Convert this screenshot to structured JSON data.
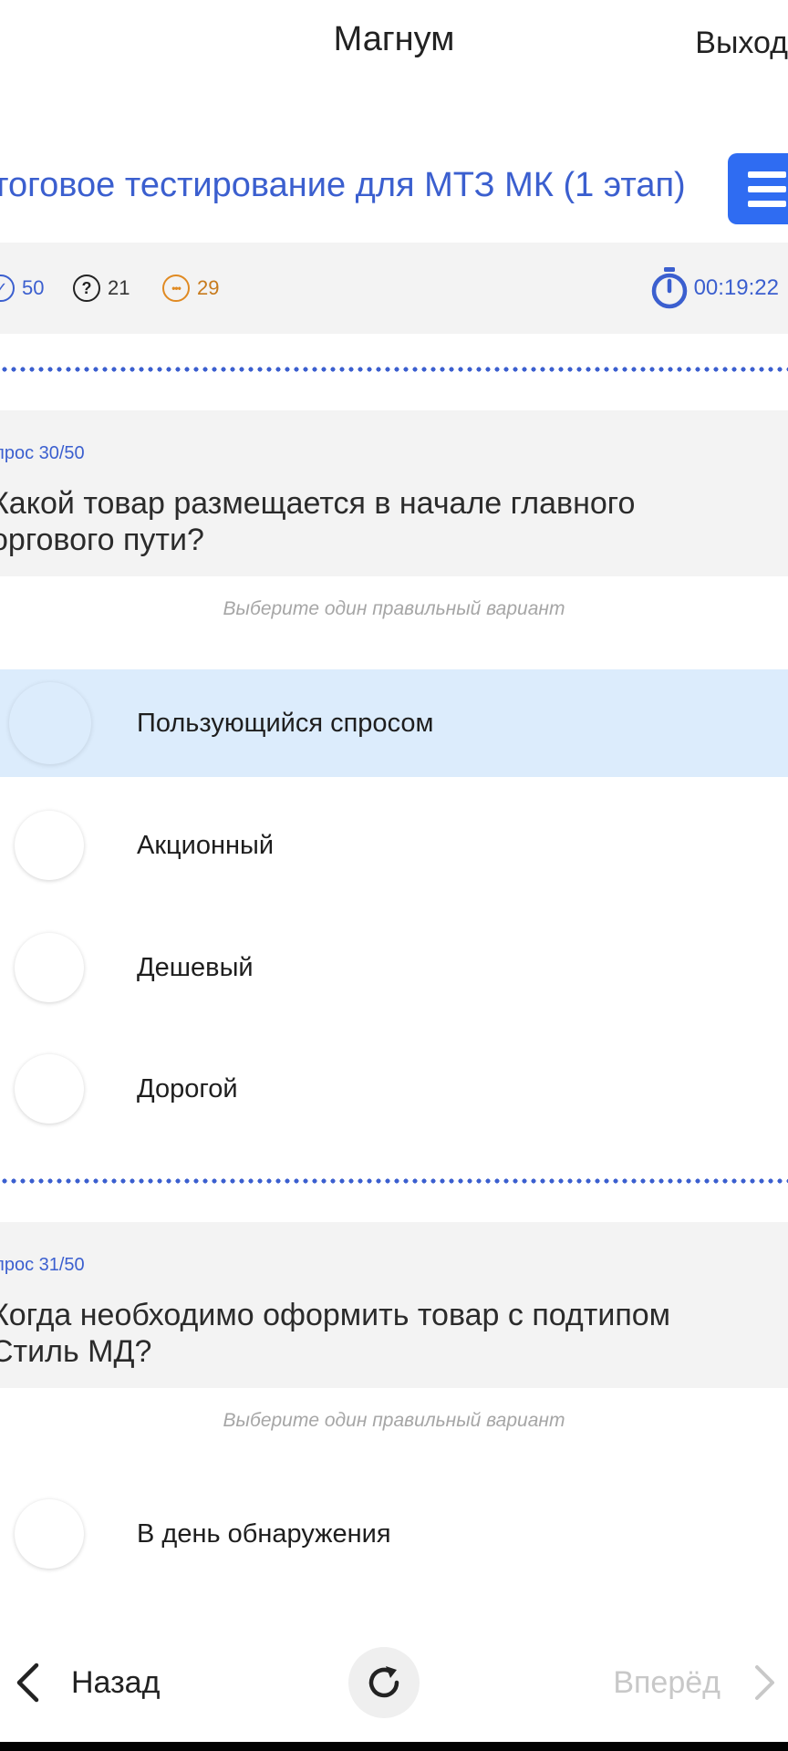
{
  "header": {
    "app_title": "Магнум",
    "logout_label": "Выход"
  },
  "test": {
    "title": "тоговое тестирование для МТЗ МК (1 этап)"
  },
  "stats": {
    "total": "50",
    "unanswered": "21",
    "answered": "29",
    "timer": "00:19:22"
  },
  "questions": [
    {
      "number_label": "прос 30/50",
      "text": "Какой товар размещается в начале главного оргового пути?",
      "hint": "Выберите один правильный вариант",
      "options": [
        {
          "label": "Пользующийся спросом",
          "selected": true
        },
        {
          "label": "Акционный",
          "selected": false
        },
        {
          "label": "Дешевый",
          "selected": false
        },
        {
          "label": "Дорогой",
          "selected": false
        }
      ]
    },
    {
      "number_label": "прос 31/50",
      "text": "Когда необходимо оформить товар с подтипом Стиль МД?",
      "hint": "Выберите один правильный вариант",
      "options": [
        {
          "label": "В день обнаружения",
          "selected": false
        }
      ]
    }
  ],
  "nav": {
    "back_label": "Назад",
    "forward_label": "Вперёд"
  },
  "colors": {
    "accent": "#3b5fcf",
    "menu_button": "#2f6cf2",
    "selected_option": "#dcecfc",
    "answered": "#e08a22"
  }
}
